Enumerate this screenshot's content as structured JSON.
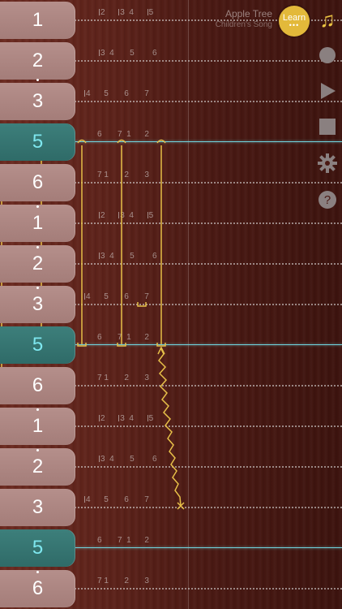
{
  "song": {
    "title": "Apple Tree",
    "subtitle": "Children's Song"
  },
  "learn": {
    "label": "Learn",
    "dots": "•••"
  },
  "toolbar": {
    "music_icon": "♫",
    "record_icon": "record-icon",
    "play_icon": "play-icon",
    "stop_icon": "stop-icon",
    "settings_icon": "gear-icon",
    "help_icon": "help-icon"
  },
  "colors": {
    "accent": "#e3b93a",
    "highlight": "#6fd3dd",
    "key": "#a47d79",
    "key_active": "#2f6b68"
  },
  "keys": [
    {
      "label": "1",
      "dot": false,
      "active": false
    },
    {
      "label": "2",
      "dot": true,
      "active": false
    },
    {
      "label": "3",
      "dot": false,
      "active": false
    },
    {
      "label": "5",
      "dot": false,
      "active": true
    },
    {
      "label": "6",
      "dot": false,
      "active": false
    },
    {
      "label": "1",
      "dot": true,
      "active": false
    },
    {
      "label": "2",
      "dot": true,
      "active": false
    },
    {
      "label": "3",
      "dot": true,
      "active": false
    },
    {
      "label": "5",
      "dot": false,
      "active": true
    },
    {
      "label": "6",
      "dot": false,
      "active": false
    },
    {
      "label": "1",
      "dot": true,
      "active": false
    },
    {
      "label": "2",
      "dot": true,
      "active": false
    },
    {
      "label": "3",
      "dot": false,
      "active": false
    },
    {
      "label": "5",
      "dot": false,
      "active": true
    },
    {
      "label": "6",
      "dot": true,
      "active": false
    }
  ],
  "string_markers": [
    [
      "2",
      "3",
      "4",
      "5"
    ],
    [
      "3",
      "4",
      "5",
      "6"
    ],
    [
      "4",
      "5",
      "6",
      "7"
    ],
    [
      "6",
      "7",
      "1",
      "2"
    ],
    [
      "7",
      "1",
      "2",
      "3"
    ],
    [
      "2",
      "3",
      "4",
      "5"
    ],
    [
      "3",
      "4",
      "5",
      "6"
    ],
    [
      "4",
      "5",
      "6",
      "7"
    ],
    [
      "6",
      "7",
      "1",
      "2"
    ],
    [
      "7",
      "1",
      "2",
      "3"
    ],
    [
      "2",
      "3",
      "4",
      "5"
    ],
    [
      "3",
      "4",
      "5",
      "6"
    ],
    [
      "4",
      "5",
      "6",
      "7"
    ],
    [
      "6",
      "7",
      "1",
      "2"
    ],
    [
      "7",
      "1",
      "2",
      "3"
    ]
  ]
}
